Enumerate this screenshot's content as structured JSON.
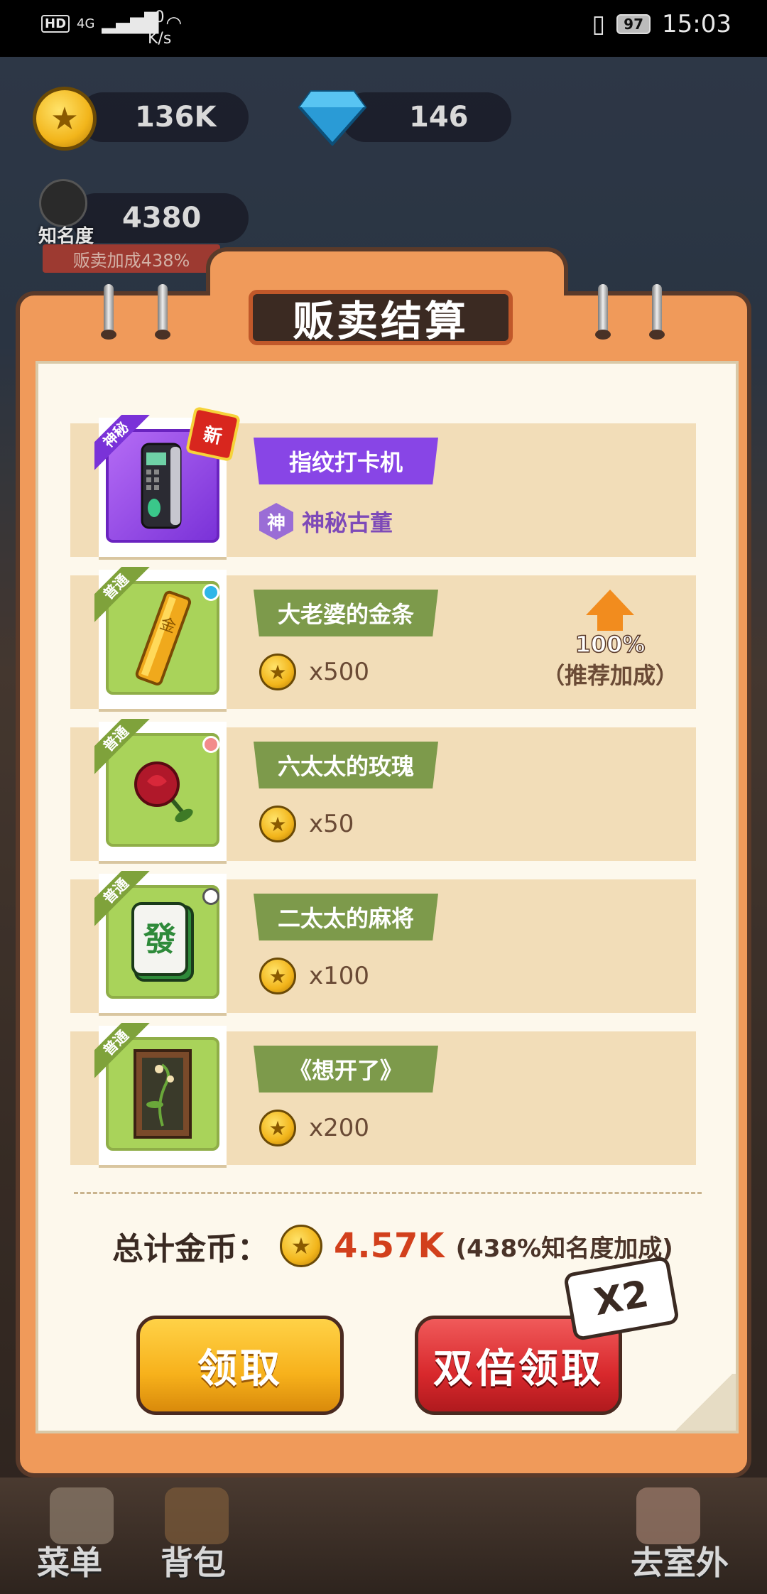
{
  "status_bar": {
    "network": "4G",
    "hd": "HD",
    "speed_value": "0",
    "speed_unit": "K/s",
    "battery": "97",
    "time": "15:03"
  },
  "hud": {
    "coins": "136K",
    "gems": "146",
    "fame_label": "知名度",
    "fame_value": "4380",
    "sell_bonus": "贩卖加成438%"
  },
  "panel": {
    "title": "贩卖结算",
    "items": [
      {
        "corner": "神秘",
        "name": "指纹打卡机",
        "rarity_icon": "神",
        "rarity_label": "神秘古董",
        "is_new": true,
        "new_label": "新"
      },
      {
        "corner": "普通",
        "name": "大老婆的金条",
        "price": "x500",
        "dot_color": "#2fb6e8",
        "boost_pct": "100%",
        "boost_label": "（推荐加成）"
      },
      {
        "corner": "普通",
        "name": "六太太的玫瑰",
        "price": "x50",
        "dot_color": "#f28b8b"
      },
      {
        "corner": "普通",
        "name": "二太太的麻将",
        "price": "x100",
        "dot_color": "#ffffff"
      },
      {
        "corner": "普通",
        "name": "《想开了》",
        "price": "x200"
      }
    ],
    "total_label": "总计金币：",
    "total_value": "4.57K",
    "total_bonus": "(438%知名度加成)",
    "claim_button": "领取",
    "double_button": "双倍领取",
    "x2_badge": "X2"
  },
  "bottom_nav": {
    "menu": "菜单",
    "bag": "背包",
    "outdoor": "去室外"
  },
  "colors": {
    "panel_orange": "#f09a5a",
    "common_green": "#7d9a4b",
    "mystery_purple": "#8845e6",
    "total_red": "#d2401c"
  }
}
